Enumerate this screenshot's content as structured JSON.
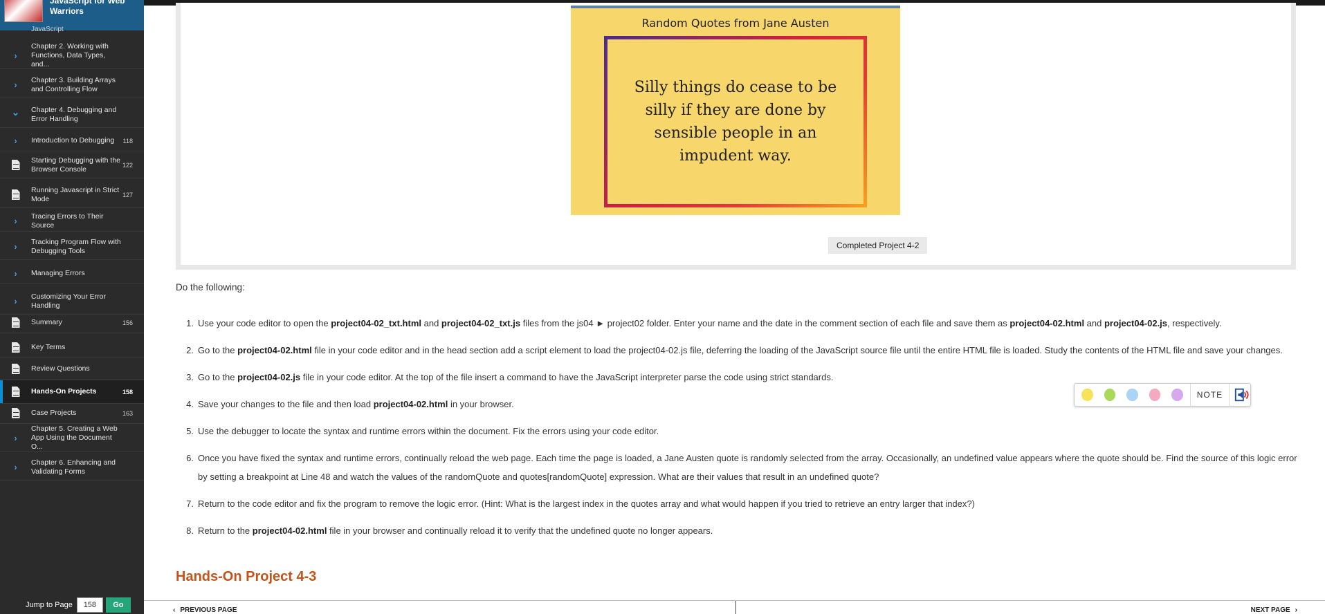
{
  "book": {
    "title": "JavaScript for Web Warriors",
    "chapter_fragment": "JavaScript"
  },
  "toc": [
    {
      "label": "Chapter 2. Working with Functions, Data Types, and...",
      "page": "",
      "icon": "chevron-right-icon"
    },
    {
      "label": "Chapter 3. Building Arrays and Controlling Flow",
      "page": "",
      "icon": "chevron-right-icon"
    },
    {
      "label": "Chapter 4. Debugging and Error Handling",
      "page": "",
      "icon": "chevron-down-icon"
    },
    {
      "label": "Introduction to Debugging",
      "page": "118",
      "icon": "chevron-right-icon"
    },
    {
      "label": "Starting Debugging with the Browser Console",
      "page": "122",
      "icon": "document-icon"
    },
    {
      "label": "Running Javascript in Strict Mode",
      "page": "127",
      "icon": "document-icon"
    },
    {
      "label": "Tracing Errors to Their Source",
      "page": "",
      "icon": "chevron-right-icon"
    },
    {
      "label": "Tracking Program Flow with Debugging Tools",
      "page": "",
      "icon": "chevron-right-icon"
    },
    {
      "label": "Managing Errors",
      "page": "",
      "icon": "chevron-right-icon"
    },
    {
      "label": "Customizing Your Error Handling",
      "page": "",
      "icon": "chevron-right-icon"
    },
    {
      "label": "Summary",
      "page": "156",
      "icon": "document-icon"
    },
    {
      "label": "Key Terms",
      "page": "",
      "icon": "document-icon"
    },
    {
      "label": "Review Questions",
      "page": "",
      "icon": "document-icon"
    },
    {
      "label": "Hands-On Projects",
      "page": "158",
      "icon": "document-icon",
      "active": true
    },
    {
      "label": "Case Projects",
      "page": "163",
      "icon": "document-icon"
    },
    {
      "label": "Chapter 5. Creating a Web App Using the Document O...",
      "page": "",
      "icon": "chevron-right-icon"
    },
    {
      "label": "Chapter 6. Enhancing and Validating Forms",
      "page": "",
      "icon": "chevron-right-icon"
    }
  ],
  "jump": {
    "label": "Jump to Page",
    "value": "158",
    "go_label": "Go"
  },
  "figure": {
    "heading": "Random Quotes from Jane Austen",
    "quote": "Silly things do cease to be silly if they are done by sensible people in an impudent way.",
    "caption": "Completed Project 4-2"
  },
  "intro": "Do the following:",
  "steps": [
    {
      "num": "1.",
      "parts": [
        {
          "t": "Use your code editor to open the "
        },
        {
          "t": "project04-02_txt.html",
          "b": true
        },
        {
          "t": " and "
        },
        {
          "t": "project04-02_txt.js",
          "b": true
        },
        {
          "t": " files from the js04 ► project02 folder. Enter your name and the date in the comment section of each file and save them as "
        },
        {
          "t": "project04-02.html",
          "b": true
        },
        {
          "t": " and "
        },
        {
          "t": "project04-02.js",
          "b": true
        },
        {
          "t": ", respectively."
        }
      ]
    },
    {
      "num": "2.",
      "parts": [
        {
          "t": "Go to the "
        },
        {
          "t": "project04-02.html",
          "b": true
        },
        {
          "t": " file in your code editor and in the head section add a script element to load the project04-02.js file, deferring the loading of the JavaScript source file until the entire HTML file is loaded. Study the contents of the HTML file and save your changes."
        }
      ]
    },
    {
      "num": "3.",
      "parts": [
        {
          "t": "Go to the "
        },
        {
          "t": "project04-02.js",
          "b": true
        },
        {
          "t": " file in your code editor. At the top of the file insert a command to have the JavaScript interpreter parse the code using strict standards."
        }
      ]
    },
    {
      "num": "4.",
      "parts": [
        {
          "t": "Save your changes to the file and then load "
        },
        {
          "t": "project04-02.html",
          "b": true
        },
        {
          "t": " in your browser."
        }
      ]
    },
    {
      "num": "5.",
      "parts": [
        {
          "t": "Use the debugger to locate the syntax and runtime errors within the document. Fix the errors using your code editor."
        }
      ]
    },
    {
      "num": "6.",
      "parts": [
        {
          "t": "Once you have fixed the syntax and runtime errors, continually reload the web page. Each time the page is loaded, a Jane Austen quote is randomly selected from the array. Occasionally, an undefined value appears where the quote should be. Find the source of this logic error by setting a breakpoint at Line 48 and watch the values of the randomQuote and quotes[randomQuote] expression. What are their values that result in an undefined quote?"
        }
      ]
    },
    {
      "num": "7.",
      "parts": [
        {
          "t": "Return to the code editor and fix the program to remove the logic error. (Hint: What is the largest index in the quotes array and what would happen if you tried to retrieve an entry larger that index?)"
        }
      ]
    },
    {
      "num": "8.",
      "parts": [
        {
          "t": "Return to the "
        },
        {
          "t": "project04-02.html",
          "b": true
        },
        {
          "t": " file in your browser and continually reload it to verify that the undefined quote no longer appears."
        }
      ]
    }
  ],
  "section_heading": "Hands-On Project 4-3",
  "highlight_toolbar": {
    "colors": [
      "#f6e35a",
      "#a8d95a",
      "#a9d4f5",
      "#f6a8c0",
      "#d7a8f0"
    ],
    "note_label": "NOTE"
  },
  "nav": {
    "prev_label": "PREVIOUS PAGE",
    "next_label": "NEXT PAGE"
  }
}
